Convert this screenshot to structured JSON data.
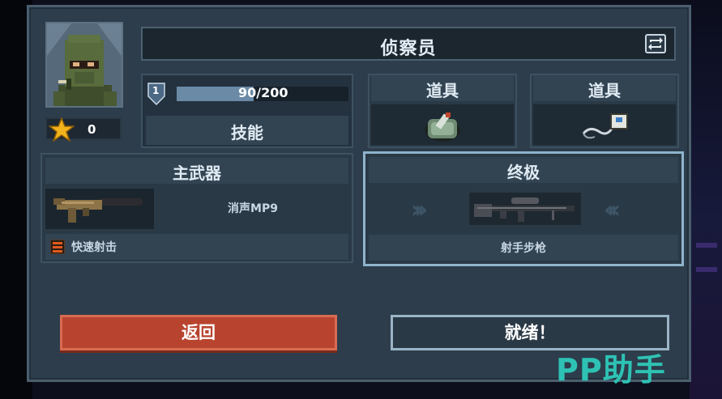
{
  "character": {
    "class_name": "侦察员",
    "star_count": "0",
    "level": "1",
    "xp_text": "90/200",
    "xp_fraction": 0.45
  },
  "skill": {
    "label": "技能"
  },
  "items": [
    {
      "label": "道具",
      "icon": "grenade-pouch-icon"
    },
    {
      "label": "道具",
      "icon": "detonator-icon"
    }
  ],
  "primary_weapon": {
    "header": "主武器",
    "name": "消声MP9",
    "trait": "快速射击"
  },
  "ultimate": {
    "header": "终极",
    "name": "射手步枪"
  },
  "buttons": {
    "back": "返回",
    "ready": "就绪！"
  },
  "watermark": "PP助手",
  "colors": {
    "back_button": "#b8442f",
    "xp_bar": "#6a8aa6",
    "ultimate_border": "#8fb4cc",
    "watermark": "#2ec2b4"
  }
}
